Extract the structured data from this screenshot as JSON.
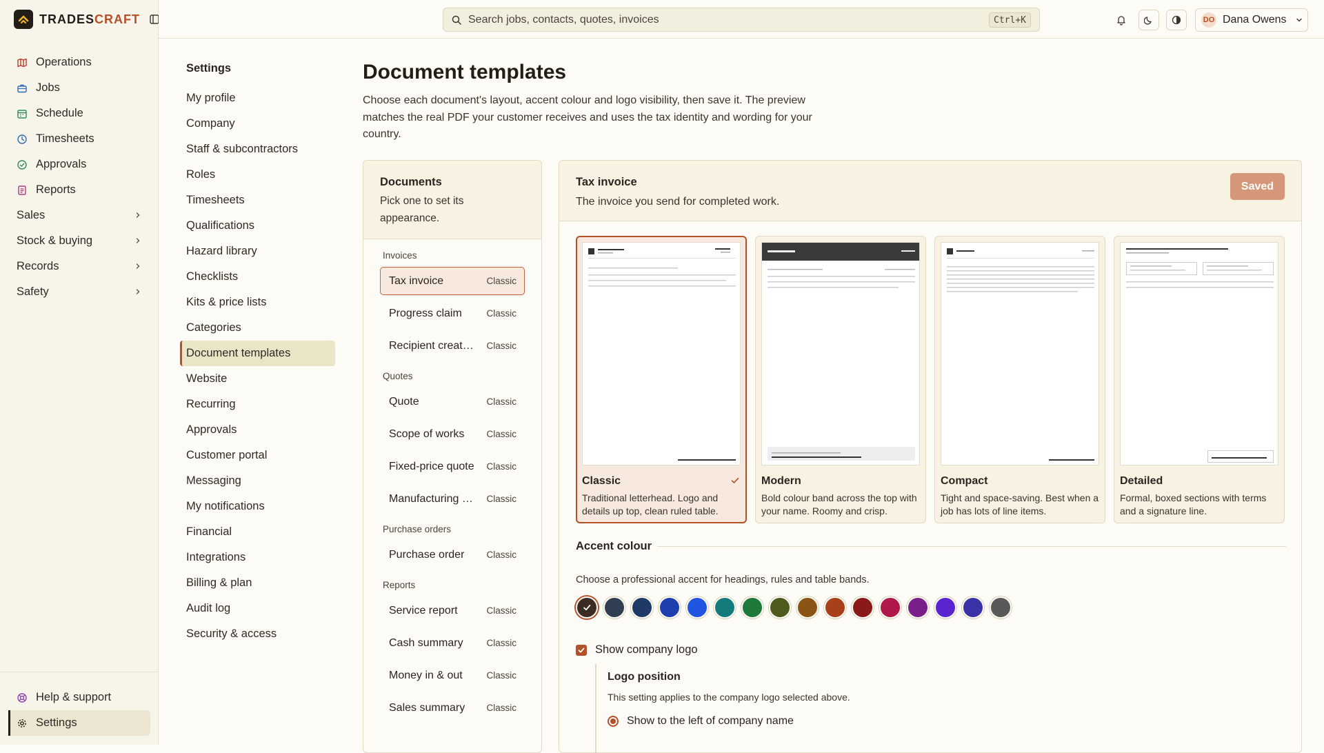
{
  "brand": {
    "name_a": "TRADES",
    "name_b": "CRAFT"
  },
  "nav": {
    "items": [
      {
        "label": "Operations",
        "icon": "map-icon",
        "color": "#c0392b"
      },
      {
        "label": "Jobs",
        "icon": "briefcase-icon",
        "color": "#2d6cb5"
      },
      {
        "label": "Schedule",
        "icon": "calendar-icon",
        "color": "#2e8b57"
      },
      {
        "label": "Timesheets",
        "icon": "clock-icon",
        "color": "#2d6cb5"
      },
      {
        "label": "Approvals",
        "icon": "check-circle-icon",
        "color": "#2e8b57"
      },
      {
        "label": "Reports",
        "icon": "report-icon",
        "color": "#b03a7a"
      }
    ],
    "groups": [
      "Sales",
      "Stock & buying",
      "Records",
      "Safety"
    ],
    "bottom": [
      {
        "label": "Help & support",
        "icon": "help-icon",
        "color": "#8a44b0"
      },
      {
        "label": "Settings",
        "icon": "gear-icon",
        "color": "#231d17"
      }
    ]
  },
  "topbar": {
    "search_placeholder": "Search jobs, contacts, quotes, invoices",
    "shortcut": "Ctrl+K",
    "user_initials": "DO",
    "user_name": "Dana Owens"
  },
  "settings_nav": {
    "title": "Settings",
    "items": [
      "My profile",
      "Company",
      "Staff & subcontractors",
      "Roles",
      "Timesheets",
      "Qualifications",
      "Hazard library",
      "Checklists",
      "Kits & price lists",
      "Categories",
      "Document templates",
      "Website",
      "Recurring",
      "Approvals",
      "Customer portal",
      "Messaging",
      "My notifications",
      "Financial",
      "Integrations",
      "Billing & plan",
      "Audit log",
      "Security & access"
    ],
    "active_index": 10
  },
  "page": {
    "title": "Document templates",
    "description": "Choose each document's layout, accent colour and logo visibility, then save it. The preview matches the real PDF your customer receives and uses the tax identity and wording for your country."
  },
  "documents": {
    "title": "Documents",
    "subtitle": "Pick one to set its appearance.",
    "groups": [
      {
        "label": "Invoices",
        "items": [
          {
            "name": "Tax invoice",
            "template": "Classic"
          },
          {
            "name": "Progress claim",
            "template": "Classic"
          },
          {
            "name": "Recipient created tax invoice",
            "template": "Classic"
          }
        ]
      },
      {
        "label": "Quotes",
        "items": [
          {
            "name": "Quote",
            "template": "Classic"
          },
          {
            "name": "Scope of works",
            "template": "Classic"
          },
          {
            "name": "Fixed-price quote",
            "template": "Classic"
          },
          {
            "name": "Manufacturing quote",
            "template": "Classic"
          }
        ]
      },
      {
        "label": "Purchase orders",
        "items": [
          {
            "name": "Purchase order",
            "template": "Classic"
          }
        ]
      },
      {
        "label": "Reports",
        "items": [
          {
            "name": "Service report",
            "template": "Classic"
          },
          {
            "name": "Cash summary",
            "template": "Classic"
          },
          {
            "name": "Money in & out",
            "template": "Classic"
          },
          {
            "name": "Sales summary",
            "template": "Classic"
          }
        ]
      }
    ]
  },
  "editor": {
    "title": "Tax invoice",
    "subtitle": "The invoice you send for completed work.",
    "save_label": "Saved",
    "templates": [
      {
        "name": "Classic",
        "desc": "Traditional letterhead. Logo and details up top, clean ruled table.",
        "selected": true
      },
      {
        "name": "Modern",
        "desc": "Bold colour band across the top with your name. Roomy and crisp.",
        "selected": false
      },
      {
        "name": "Compact",
        "desc": "Tight and space-saving. Best when a job has lots of line items.",
        "selected": false
      },
      {
        "name": "Detailed",
        "desc": "Formal, boxed sections with terms and a signature line.",
        "selected": false
      }
    ],
    "accent_title": "Accent colour",
    "accent_desc": "Choose a professional accent for headings, rules and table bands.",
    "swatches": [
      "#3a2c22",
      "#2f3e52",
      "#1f3a66",
      "#1f3fae",
      "#1f55e0",
      "#157a7a",
      "#1d7a3a",
      "#4f5a1f",
      "#8a5514",
      "#a8401a",
      "#8a1a1a",
      "#b0174a",
      "#7a1f8a",
      "#5a24d0",
      "#3a33a8",
      "#595959"
    ],
    "selected_swatch": 0,
    "show_logo_label": "Show company logo",
    "logo_position_title": "Logo position",
    "logo_position_desc": "This setting applies to the company logo selected above.",
    "logo_option": "Show to the left of company name"
  }
}
